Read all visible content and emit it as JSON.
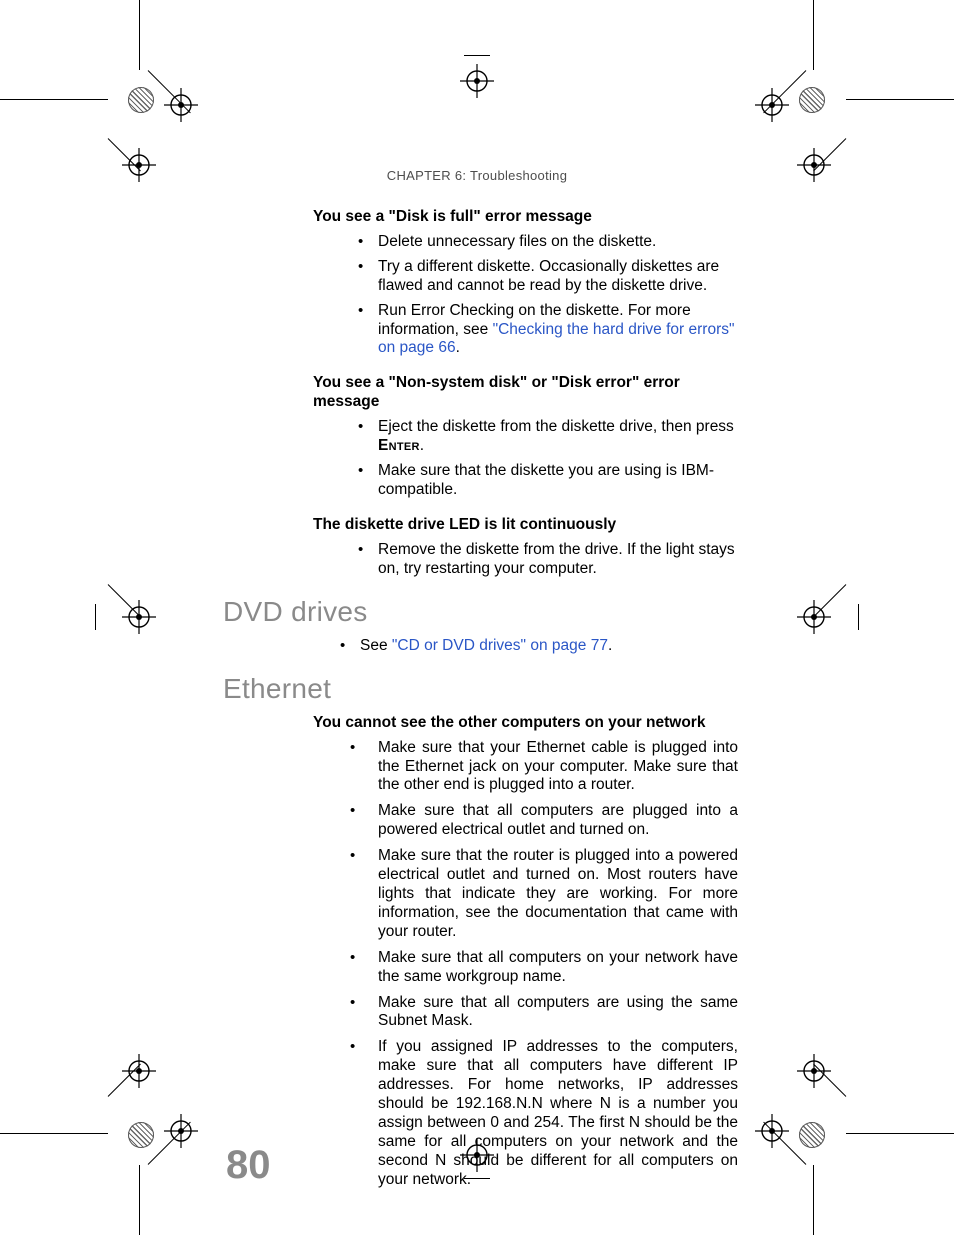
{
  "chapter": "CHAPTER 6: Troubleshooting",
  "page_number": "80",
  "s1": {
    "h": "You see a \"Disk is full\" error message",
    "b1": "Delete unnecessary files on the diskette.",
    "b2": "Try a different diskette. Occasionally diskettes are flawed and cannot be read by the diskette drive.",
    "b3a": "Run Error Checking on the diskette. For more information, see ",
    "b3link": "\"Checking the hard drive for errors\" on page 66",
    "b3c": "."
  },
  "s2": {
    "h": "You see a \"Non-system disk\" or \"Disk error\" error message",
    "b1a": "Eject the diskette from the diskette drive, then press ",
    "b1key": "Enter",
    "b1c": ".",
    "b2": "Make sure that the diskette you are using is IBM-compatible."
  },
  "s3": {
    "h": "The diskette drive LED is lit continuously",
    "b1": "Remove the diskette from the drive. If the light stays on, try restarting your computer."
  },
  "dvd": {
    "title": "DVD drives",
    "b1a": "See ",
    "b1link": "\"CD or DVD drives\" on page 77",
    "b1c": "."
  },
  "eth": {
    "title": "Ethernet",
    "h": "You cannot see the other computers on your network",
    "b1": "Make sure that your Ethernet cable is plugged into the Ethernet jack on your computer. Make sure that the other end is plugged into a router.",
    "b2": "Make sure that all computers are plugged into a powered electrical outlet and turned on.",
    "b3": "Make sure that the router is plugged into a powered electrical outlet and turned on. Most routers have lights that indicate they are working. For more information, see the documentation that came with your router.",
    "b4": "Make sure that all computers on your network have the same workgroup name.",
    "b5": "Make sure that all computers are using the same Subnet Mask.",
    "b6": "If you assigned IP addresses to the computers, make sure that all computers have different IP addresses. For home networks, IP addresses should be 192.168.N.N where N is a number you assign between 0 and 254. The first N should be the same for all computers on your network and the second N should be different for all computers on your network."
  }
}
